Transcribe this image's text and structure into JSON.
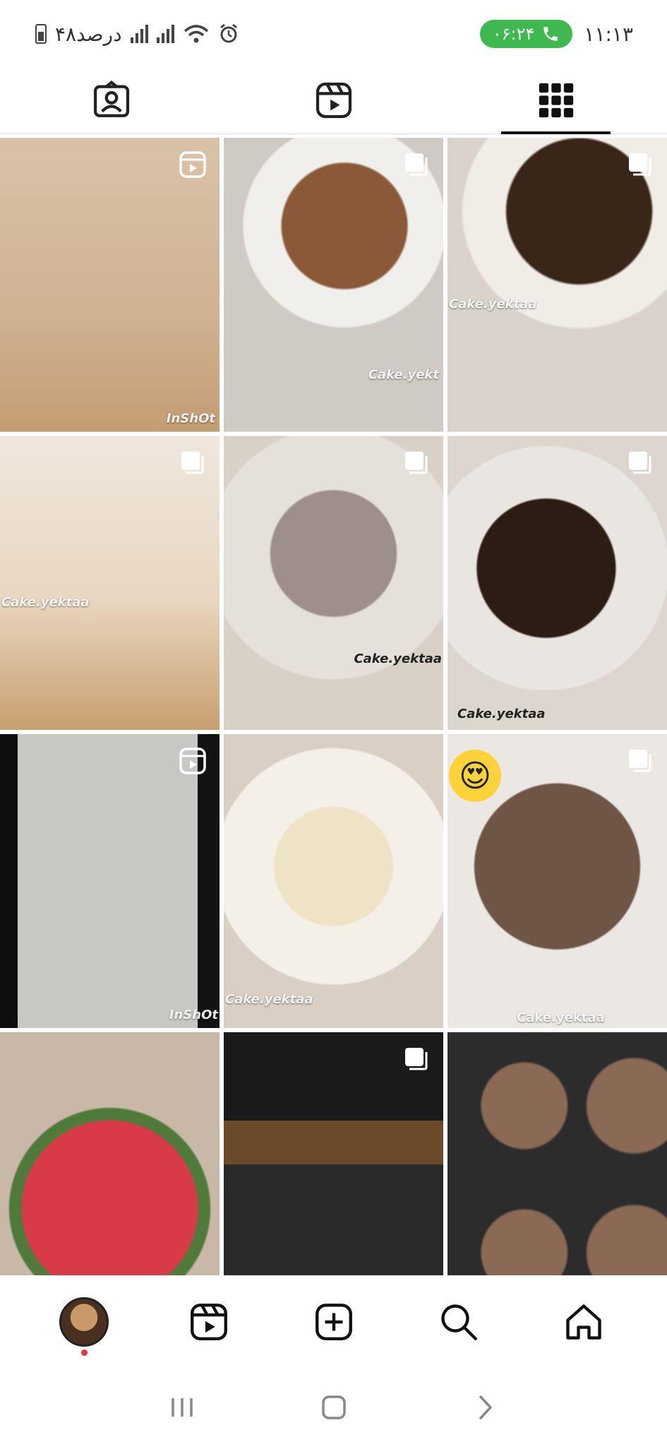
{
  "status_bar": {
    "battery_text": "۴۸درصد",
    "call_time": "۰۶:۲۴",
    "clock": "۱۱:۱۳"
  },
  "profile_tabs": [
    {
      "name": "tagged",
      "icon": "person-tag-icon",
      "active": false
    },
    {
      "name": "reels",
      "icon": "reels-icon",
      "active": false
    },
    {
      "name": "posts-grid",
      "icon": "grid-icon",
      "active": true
    }
  ],
  "grid": {
    "tiles": [
      {
        "id": "1",
        "badge": "reel",
        "watermark": "InShOt"
      },
      {
        "id": "2",
        "badge": "carousel",
        "watermark": "Cake.yekt"
      },
      {
        "id": "3",
        "badge": "carousel",
        "watermark": "Cake.yektaa"
      },
      {
        "id": "4",
        "badge": "carousel",
        "watermark": "Cake.yektaa"
      },
      {
        "id": "5",
        "badge": "carousel",
        "watermark": "Cake.yektaa"
      },
      {
        "id": "6",
        "badge": "carousel",
        "watermark": "Cake.yektaa"
      },
      {
        "id": "7",
        "badge": "reel",
        "watermark": "InShOt"
      },
      {
        "id": "8",
        "badge": "none",
        "watermark": "Cake.yektaa"
      },
      {
        "id": "9",
        "badge": "carousel",
        "watermark": "Cake.yektaa"
      },
      {
        "id": "10",
        "badge": "none",
        "watermark": ""
      },
      {
        "id": "11",
        "badge": "carousel",
        "watermark": ""
      },
      {
        "id": "12",
        "badge": "none",
        "watermark": ""
      }
    ]
  },
  "bottom_nav": [
    {
      "name": "profile",
      "icon": "avatar"
    },
    {
      "name": "reels",
      "icon": "reels-icon"
    },
    {
      "name": "create",
      "icon": "plus-square-icon"
    },
    {
      "name": "search",
      "icon": "search-icon"
    },
    {
      "name": "home",
      "icon": "home-icon"
    }
  ],
  "system_nav": [
    "recents-icon",
    "home-circle-icon",
    "back-icon"
  ],
  "colors": {
    "call_pill": "#3fb84f",
    "notification_dot": "#e5343d",
    "active_tab_bar": "#111111"
  }
}
